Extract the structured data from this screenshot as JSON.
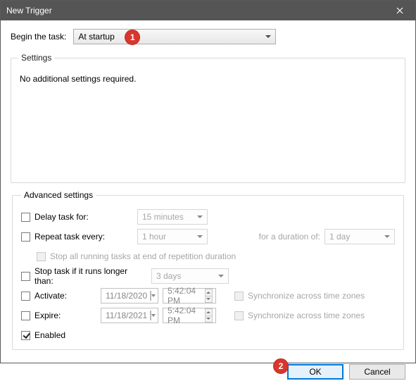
{
  "window": {
    "title": "New Trigger"
  },
  "begin": {
    "label": "Begin the task:",
    "value": "At startup"
  },
  "settings": {
    "legend": "Settings",
    "body": "No additional settings required."
  },
  "advanced": {
    "legend": "Advanced settings",
    "delay": {
      "label": "Delay task for:",
      "value": "15 minutes",
      "checked": false
    },
    "repeat": {
      "label": "Repeat task every:",
      "value": "1 hour",
      "duration_label": "for a duration of:",
      "duration_value": "1 day",
      "checked": false
    },
    "stop_end": {
      "label": "Stop all running tasks at end of repetition duration",
      "checked": false
    },
    "stop_if": {
      "label": "Stop task if it runs longer than:",
      "value": "3 days",
      "checked": false
    },
    "activate": {
      "label": "Activate:",
      "date": "11/18/2020",
      "time": "5:42:04 PM",
      "sync_label": "Synchronize across time zones",
      "checked": false
    },
    "expire": {
      "label": "Expire:",
      "date": "11/18/2021",
      "time": "5:42:04 PM",
      "sync_label": "Synchronize across time zones",
      "checked": false
    },
    "enabled": {
      "label": "Enabled",
      "checked": true
    }
  },
  "buttons": {
    "ok": "OK",
    "cancel": "Cancel"
  },
  "markers": {
    "m1": "1",
    "m2": "2"
  }
}
